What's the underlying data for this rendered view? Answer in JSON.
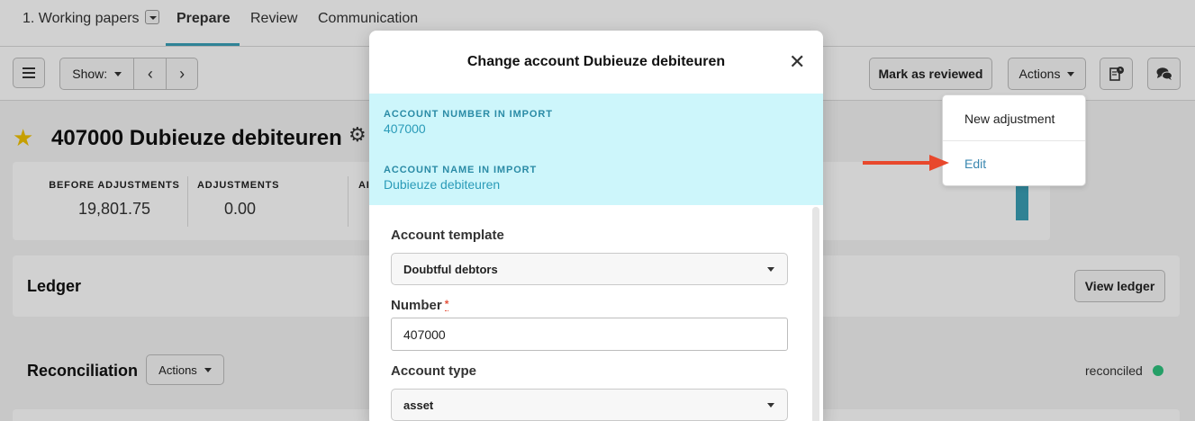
{
  "topnav": {
    "working_papers": "1. Working papers",
    "prepare": "Prepare",
    "review": "Review",
    "communication": "Communication"
  },
  "toolbar": {
    "show_label": "Show:",
    "mark_reviewed": "Mark as reviewed",
    "actions": "Actions"
  },
  "account": {
    "title": "407000 Dubieuze debiteuren"
  },
  "summary": {
    "before_adjustments_label": "BEFORE ADJUSTMENTS",
    "before_adjustments_value": "19,801.75",
    "adjustments_label": "ADJUSTMENTS",
    "adjustments_value": "0.00",
    "third_label_partial": "AI"
  },
  "ledger": {
    "title": "Ledger",
    "view_button": "View ledger"
  },
  "reconciliation": {
    "title": "Reconciliation",
    "actions": "Actions",
    "status": "reconciled",
    "status_color": "#2ec27e"
  },
  "dropdown": {
    "items": [
      "New adjustment",
      "Edit"
    ]
  },
  "modal": {
    "title": "Change account Dubieuze debiteuren",
    "import_number_label": "ACCOUNT NUMBER IN IMPORT",
    "import_number_value": "407000",
    "import_name_label": "ACCOUNT NAME IN IMPORT",
    "import_name_value": "Dubieuze debiteuren",
    "template_label": "Account template",
    "template_value": "Doubtful debtors",
    "number_label": "Number",
    "number_required": "*",
    "number_value": "407000",
    "type_label": "Account type",
    "type_value": "asset"
  },
  "colors": {
    "accent": "#3aa0b8",
    "annotation_arrow": "#e8482c",
    "import_bg": "#cdf6fb"
  }
}
